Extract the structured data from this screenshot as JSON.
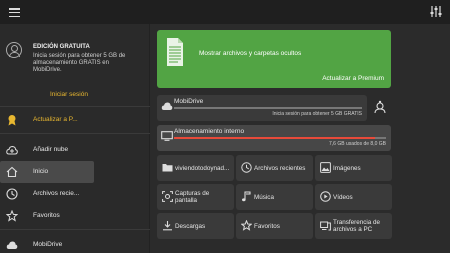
{
  "sidebar": {
    "promo": {
      "edition": "EDICIÓN GRATUITA",
      "description": "Inicia sesión para obtener 5 GB de almacenamiento GRATIS en MobiDrive.",
      "login": "Iniciar sesión"
    },
    "items": [
      {
        "label": "Actualizar a P...",
        "icon": "premium-icon"
      },
      {
        "label": "Añadir nube",
        "icon": "cloud-add-icon"
      },
      {
        "label": "Inicio",
        "icon": "home-icon"
      },
      {
        "label": "Archivos recie...",
        "icon": "recent-icon"
      },
      {
        "label": "Favoritos",
        "icon": "star-icon"
      },
      {
        "label": "MobiDrive",
        "icon": "cloud-icon"
      }
    ]
  },
  "banner": {
    "text": "Mostrar archivos y carpetas ocultos",
    "cta": "Actualizar a Premium"
  },
  "storage": [
    {
      "name": "MobiDrive",
      "sub": "Inicia sesión para obtener 5 GB GRATIS",
      "fill": 0
    },
    {
      "name": "Almacenamiento interno",
      "sub": "7,6 GB usados de 8,0 GB",
      "fill": 0.95
    }
  ],
  "grid": [
    {
      "label": "viviendotodoynad...",
      "icon": "folder-icon"
    },
    {
      "label": "Archivos recientes",
      "icon": "recent-icon"
    },
    {
      "label": "Imágenes",
      "icon": "image-icon"
    },
    {
      "label": "Capturas de pantalla",
      "icon": "screenshot-icon"
    },
    {
      "label": "Música",
      "icon": "music-icon"
    },
    {
      "label": "Vídeos",
      "icon": "video-icon"
    },
    {
      "label": "Descargas",
      "icon": "download-icon"
    },
    {
      "label": "Favoritos",
      "icon": "star-icon"
    },
    {
      "label": "Transferencia de archivos a PC",
      "icon": "transfer-icon"
    }
  ],
  "colors": {
    "accent": "#e8b730",
    "banner": "#52a444",
    "progress": "#e84a3a"
  }
}
